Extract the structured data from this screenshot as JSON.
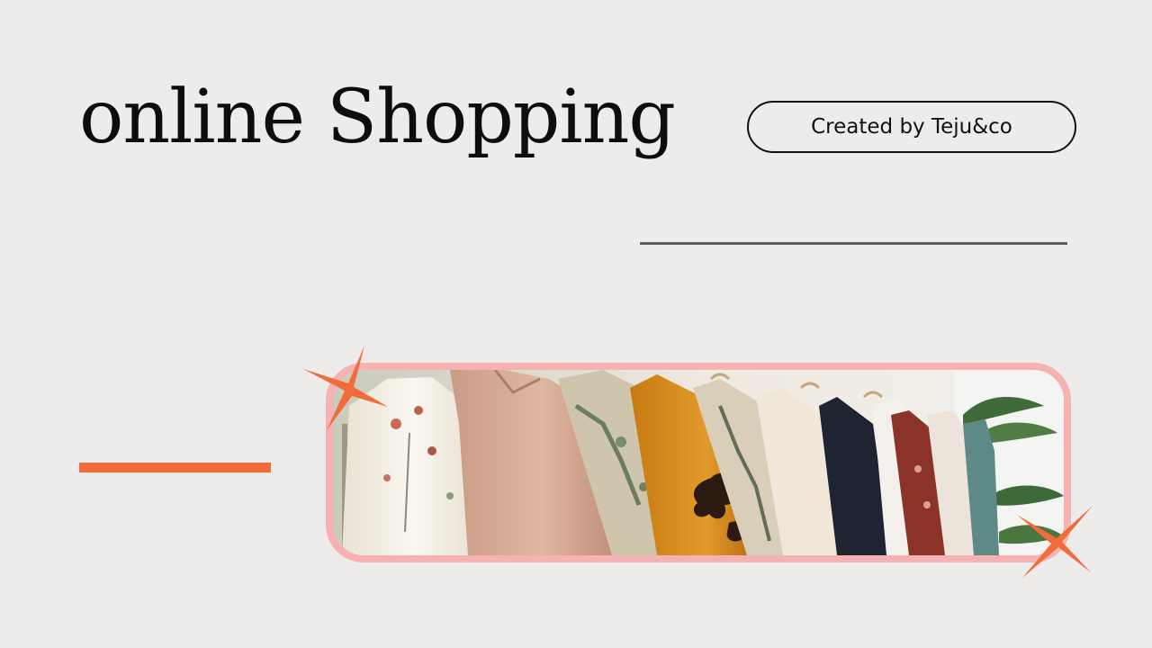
{
  "slide": {
    "title": "online Shopping",
    "credit_label": "Created by Teju&co"
  },
  "colors": {
    "background": "#edecea",
    "accent_orange": "#f26b3b",
    "frame_pink": "#f6b2b2",
    "divider_gray": "#5e5e5e",
    "text_black": "#0d0d0d"
  },
  "icons": {
    "decorative": [
      "sparkle-icon",
      "sparkle-icon"
    ]
  },
  "image": {
    "subject": "clothing-rack-photo"
  }
}
